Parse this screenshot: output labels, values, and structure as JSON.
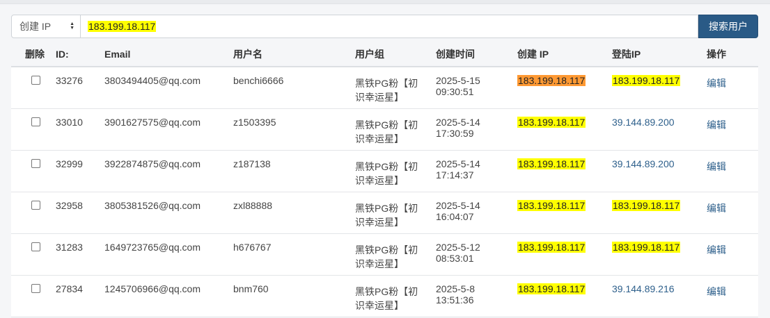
{
  "search": {
    "select_label": "创建 IP",
    "query": "183.199.18.117",
    "button_label": "搜索用户"
  },
  "table": {
    "headers": {
      "delete": "删除",
      "id": "ID:",
      "email": "Email",
      "username": "用户名",
      "group": "用户组",
      "created_time": "创建时间",
      "created_ip": "创建 IP",
      "login_ip": "登陆IP",
      "action": "操作"
    },
    "rows": [
      {
        "id": "33276",
        "email": "3803494405@qq.com",
        "username": "benchi6666",
        "group_line1": "黑铁PG粉【初",
        "group_line2": "识幸运星】",
        "date": "2025-5-15",
        "time": "09:30:51",
        "created_ip": "183.199.18.117",
        "login_ip": "183.199.18.117",
        "action": "编辑"
      },
      {
        "id": "33010",
        "email": "3901627575@qq.com",
        "username": "z1503395",
        "group_line1": "黑铁PG粉【初",
        "group_line2": "识幸运星】",
        "date": "2025-5-14",
        "time": "17:30:59",
        "created_ip": "183.199.18.117",
        "login_ip": "39.144.89.200",
        "action": "编辑"
      },
      {
        "id": "32999",
        "email": "3922874875@qq.com",
        "username": "z187138",
        "group_line1": "黑铁PG粉【初",
        "group_line2": "识幸运星】",
        "date": "2025-5-14",
        "time": "17:14:37",
        "created_ip": "183.199.18.117",
        "login_ip": "39.144.89.200",
        "action": "编辑"
      },
      {
        "id": "32958",
        "email": "3805381526@qq.com",
        "username": "zxl88888",
        "group_line1": "黑铁PG粉【初",
        "group_line2": "识幸运星】",
        "date": "2025-5-14",
        "time": "16:04:07",
        "created_ip": "183.199.18.117",
        "login_ip": "183.199.18.117",
        "action": "编辑"
      },
      {
        "id": "31283",
        "email": "1649723765@qq.com",
        "username": "h676767",
        "group_line1": "黑铁PG粉【初",
        "group_line2": "识幸运星】",
        "date": "2025-5-12",
        "time": "08:53:01",
        "created_ip": "183.199.18.117",
        "login_ip": "183.199.18.117",
        "action": "编辑"
      },
      {
        "id": "27834",
        "email": "1245706966@qq.com",
        "username": "bnm760",
        "group_line1": "黑铁PG粉【初",
        "group_line2": "识幸运星】",
        "date": "2025-5-8",
        "time": "13:51:36",
        "created_ip": "183.199.18.117",
        "login_ip": "39.144.89.216",
        "action": "编辑"
      }
    ]
  },
  "colors": {
    "highlight_match": "#ffff00",
    "highlight_current": "#ff9933",
    "button_bg": "#2a5a86",
    "link": "#2d5f8b"
  }
}
